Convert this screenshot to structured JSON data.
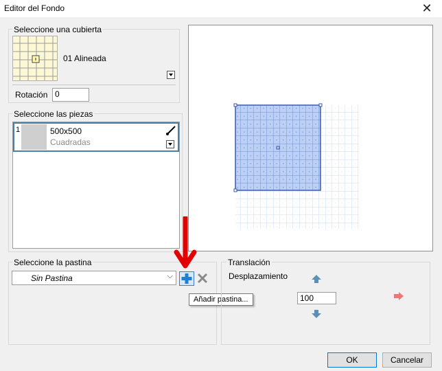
{
  "window": {
    "title": "Editor del Fondo"
  },
  "cover": {
    "group_label": "Seleccione una cubierta",
    "name": "01 Alineada",
    "rotation_label": "Rotación",
    "rotation_value": "0"
  },
  "pieces": {
    "group_label": "Seleccione las piezas",
    "items": [
      {
        "index": "1",
        "name": "500x500",
        "subtitle": "Cuadradas"
      }
    ]
  },
  "grout": {
    "group_label": "Seleccione la pastina",
    "selected": "Sin Pastina",
    "tooltip": "Añadir pastina..."
  },
  "translation": {
    "group_label": "Translación",
    "displacement_label": "Desplazamiento",
    "displacement_value": "100"
  },
  "buttons": {
    "ok": "OK",
    "cancel": "Cancelar"
  },
  "colors": {
    "cover_thumb_bg": "#fcf8d6",
    "selected_tile_fill": "#bcd0f5",
    "arrow_up_down": "#5b8fb5",
    "arrow_right": "#e87979",
    "annotation_arrow": "#e30000",
    "add_button": "#1f7fd6",
    "remove_button": "#8a8a8a"
  }
}
